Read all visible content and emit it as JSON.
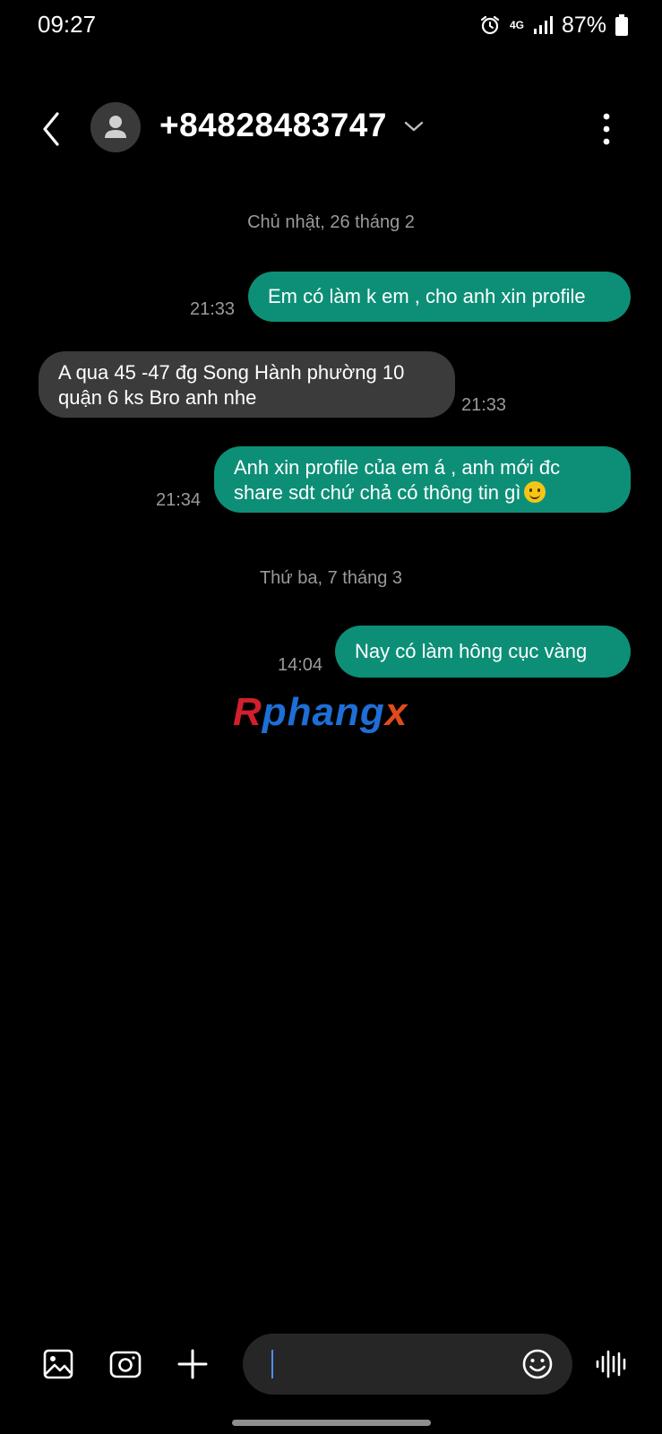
{
  "status_bar": {
    "time": "09:27",
    "network": "4G",
    "battery": "87%"
  },
  "header": {
    "contact": "+84828483747",
    "icons": [
      "back-icon",
      "contact-avatar-icon",
      "chevron-down-icon",
      "more-vert-icon"
    ]
  },
  "conversation": {
    "date_1": "Chủ nhật, 26 tháng 2",
    "date_2": "Thứ ba, 7 tháng 3",
    "messages": [
      {
        "direction": "outgoing",
        "text": "Em có làm k em , cho anh xin profile",
        "time": "21:33"
      },
      {
        "direction": "incoming",
        "line1": "A qua 45 -47 đg Song Hành phường 10",
        "line2": "quận 6 ks Bro anh nhe",
        "time": "21:33"
      },
      {
        "direction": "outgoing",
        "line1": "Anh xin profile của em á , anh mới đc",
        "line2": "share sdt chứ chả có thông tin gì",
        "emoji": "smiling-face",
        "time": "21:34"
      },
      {
        "direction": "outgoing",
        "text": "Nay có làm hông cục vàng",
        "time": "14:04"
      }
    ]
  },
  "watermark": {
    "first": "R",
    "middle": "phang",
    "last": "x"
  },
  "composer": {
    "value": "",
    "icons": [
      "gallery-icon",
      "camera-icon",
      "plus-icon",
      "emoji-icon",
      "voice-waveform-icon"
    ]
  },
  "colors": {
    "outgoing_bubble": "#0d8f77",
    "incoming_bubble": "#3b3b3b",
    "background": "#000000"
  }
}
